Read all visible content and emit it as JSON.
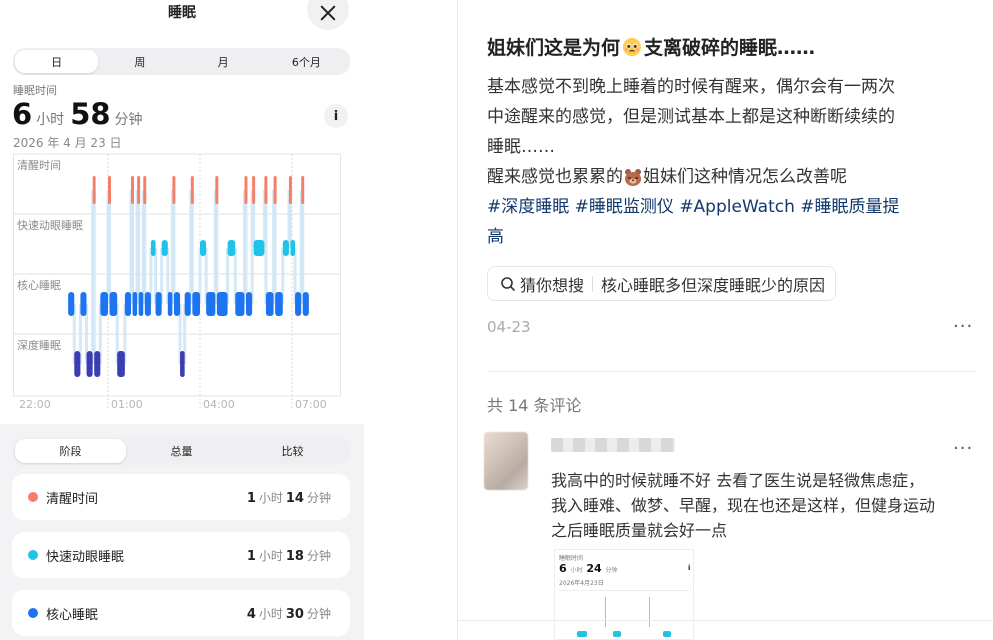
{
  "sleep_app": {
    "title": "睡眠",
    "range_tabs": [
      "日",
      "周",
      "月",
      "6个月"
    ],
    "active_range": 0,
    "metric_label": "睡眠时间",
    "duration": {
      "hours": "6",
      "hours_unit": "小时",
      "minutes": "58",
      "minutes_unit": "分钟"
    },
    "info_label": "i",
    "date": "2026 年 4 月 23 日",
    "stats_tabs": [
      "阶段",
      "总量",
      "比较"
    ],
    "active_stats": 0,
    "stages": [
      {
        "name": "清醒时间",
        "color": "#f4806a",
        "hours": "1",
        "hours_unit": "小时",
        "minutes": "14",
        "minutes_unit": "分钟"
      },
      {
        "name": "快速动眼睡眠",
        "color": "#20c3e8",
        "hours": "1",
        "hours_unit": "小时",
        "minutes": "18",
        "minutes_unit": "分钟"
      },
      {
        "name": "核心睡眠",
        "color": "#1e74f0",
        "hours": "4",
        "hours_unit": "小时",
        "minutes": "30",
        "minutes_unit": "分钟"
      }
    ]
  },
  "chart_data": {
    "type": "timeline",
    "rows": [
      "清醒时间",
      "快速动眼睡眠",
      "核心睡眠",
      "深度睡眠"
    ],
    "row_colors": [
      "#f4806a",
      "#20c3e8",
      "#1e74f0",
      "#3a3eb2"
    ],
    "x_ticks": [
      "22:00",
      "01:00",
      "04:00",
      "07:00"
    ],
    "x_range_hours": [
      22.0,
      32.5
    ],
    "segments": [
      {
        "stage": 2,
        "start": 23.7,
        "end": 23.9
      },
      {
        "stage": 3,
        "start": 23.9,
        "end": 24.1
      },
      {
        "stage": 2,
        "start": 24.1,
        "end": 24.3
      },
      {
        "stage": 3,
        "start": 24.3,
        "end": 24.5
      },
      {
        "stage": 0,
        "start": 24.5,
        "end": 24.55
      },
      {
        "stage": 3,
        "start": 24.55,
        "end": 24.75
      },
      {
        "stage": 2,
        "start": 24.75,
        "end": 25.0
      },
      {
        "stage": 0,
        "start": 25.0,
        "end": 25.05
      },
      {
        "stage": 2,
        "start": 25.05,
        "end": 25.3
      },
      {
        "stage": 3,
        "start": 25.3,
        "end": 25.55
      },
      {
        "stage": 2,
        "start": 25.55,
        "end": 25.75
      },
      {
        "stage": 0,
        "start": 25.75,
        "end": 25.8
      },
      {
        "stage": 2,
        "start": 25.8,
        "end": 25.95
      },
      {
        "stage": 0,
        "start": 25.95,
        "end": 26.0
      },
      {
        "stage": 2,
        "start": 26.0,
        "end": 26.15
      },
      {
        "stage": 0,
        "start": 26.15,
        "end": 26.2
      },
      {
        "stage": 2,
        "start": 26.2,
        "end": 26.4
      },
      {
        "stage": 1,
        "start": 26.4,
        "end": 26.55
      },
      {
        "stage": 2,
        "start": 26.55,
        "end": 26.75
      },
      {
        "stage": 1,
        "start": 26.75,
        "end": 26.95
      },
      {
        "stage": 2,
        "start": 26.95,
        "end": 27.1
      },
      {
        "stage": 0,
        "start": 27.1,
        "end": 27.15
      },
      {
        "stage": 2,
        "start": 27.15,
        "end": 27.35
      },
      {
        "stage": 3,
        "start": 27.35,
        "end": 27.5
      },
      {
        "stage": 2,
        "start": 27.5,
        "end": 27.7
      },
      {
        "stage": 0,
        "start": 27.7,
        "end": 27.75
      },
      {
        "stage": 2,
        "start": 27.75,
        "end": 28.0
      },
      {
        "stage": 1,
        "start": 28.0,
        "end": 28.2
      },
      {
        "stage": 2,
        "start": 28.2,
        "end": 28.5
      },
      {
        "stage": 0,
        "start": 28.5,
        "end": 28.55
      },
      {
        "stage": 2,
        "start": 28.55,
        "end": 28.9
      },
      {
        "stage": 1,
        "start": 28.9,
        "end": 29.15
      },
      {
        "stage": 2,
        "start": 29.15,
        "end": 29.45
      },
      {
        "stage": 0,
        "start": 29.45,
        "end": 29.5
      },
      {
        "stage": 2,
        "start": 29.5,
        "end": 29.7
      },
      {
        "stage": 0,
        "start": 29.7,
        "end": 29.75
      },
      {
        "stage": 1,
        "start": 29.75,
        "end": 30.1
      },
      {
        "stage": 0,
        "start": 30.1,
        "end": 30.15
      },
      {
        "stage": 2,
        "start": 30.15,
        "end": 30.4
      },
      {
        "stage": 0,
        "start": 30.4,
        "end": 30.45
      },
      {
        "stage": 2,
        "start": 30.45,
        "end": 30.7
      },
      {
        "stage": 1,
        "start": 30.7,
        "end": 30.9
      },
      {
        "stage": 0,
        "start": 30.9,
        "end": 30.95
      },
      {
        "stage": 1,
        "start": 30.95,
        "end": 31.1
      },
      {
        "stage": 2,
        "start": 31.1,
        "end": 31.3
      },
      {
        "stage": 0,
        "start": 31.3,
        "end": 31.35
      },
      {
        "stage": 2,
        "start": 31.35,
        "end": 31.55
      }
    ]
  },
  "post": {
    "title_part1": "姐妹们这是为何",
    "title_part2": "支离破碎的睡眠……",
    "body_lines": [
      "基本感觉不到晚上睡着的时候有醒来，偶尔会有一两次",
      "中途醒来的感觉，但是测试基本上都是这种断断续续的",
      "睡眠……"
    ],
    "body_line4_part1": "醒来感觉也累累的",
    "body_line4_part2": "姐妹们这种情况怎么改善呢",
    "tags_line1": [
      "#深度睡眠",
      "#睡眠监测仪",
      "#AppleWatch",
      "#睡眠质量提"
    ],
    "tags_line2": "高",
    "search_chip": {
      "prefix": "猜你想搜",
      "query": "核心睡眠多但深度睡眠少的原因"
    },
    "date": "04-23",
    "more": "···",
    "comment_count": "共 14 条评论"
  },
  "comment": {
    "text_lines": [
      "我高中的时候就睡不好 去看了医生说是轻微焦虑症，",
      "我入睡难、做梦、早醒，现在也还是这样，但健身运动",
      "之后睡眠质量就会好一点"
    ],
    "more": "···",
    "thumb": {
      "label": "睡眠时间",
      "hours": "6",
      "hours_unit": "小时",
      "minutes": "24",
      "minutes_unit": "分钟",
      "date": "2026年4月23日",
      "info": "i"
    }
  }
}
